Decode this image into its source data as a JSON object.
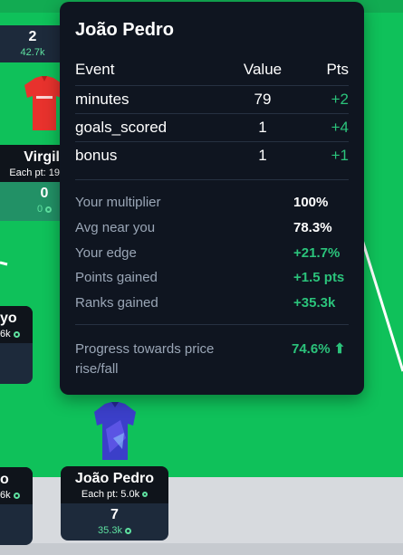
{
  "tooltip": {
    "title": "João Pedro",
    "table_headers": {
      "event": "Event",
      "value": "Value",
      "pts": "Pts"
    },
    "rows": [
      {
        "event": "minutes",
        "value": "79",
        "pts": "+2"
      },
      {
        "event": "goals_scored",
        "value": "1",
        "pts": "+4"
      },
      {
        "event": "bonus",
        "value": "1",
        "pts": "+1"
      }
    ],
    "stats": [
      {
        "label": "Your multiplier",
        "value": "100%"
      },
      {
        "label": "Avg near you",
        "value": "78.3%"
      },
      {
        "label": "Your edge",
        "value": "+21.7%"
      },
      {
        "label": "Points gained",
        "value": "+1.5 pts"
      },
      {
        "label": "Ranks gained",
        "value": "+35.3k"
      }
    ],
    "progress": {
      "label": "Progress towards price rise/fall",
      "value": "74.6% ⬆"
    }
  },
  "players": {
    "top_left": {
      "points": "2",
      "owned": "42.7k"
    },
    "virgil": {
      "name": "Virgil",
      "each_pt": "Each pt: 19",
      "points": "0",
      "owned": "0"
    },
    "left_mid": {
      "name": "yo",
      "owned": "6k"
    },
    "left_bottom": {
      "name": "o",
      "owned": "6k"
    },
    "joao": {
      "name": "João Pedro",
      "each_pt": "Each pt: 5.0k",
      "points": "7",
      "owned": "35.3k"
    }
  },
  "colors": {
    "pitch": "#0fc15a",
    "accent_green": "#2bc37b",
    "tooltip_bg": "#0f1520",
    "card_dark": "#0f141b",
    "card_light": "#1d2a3b"
  }
}
